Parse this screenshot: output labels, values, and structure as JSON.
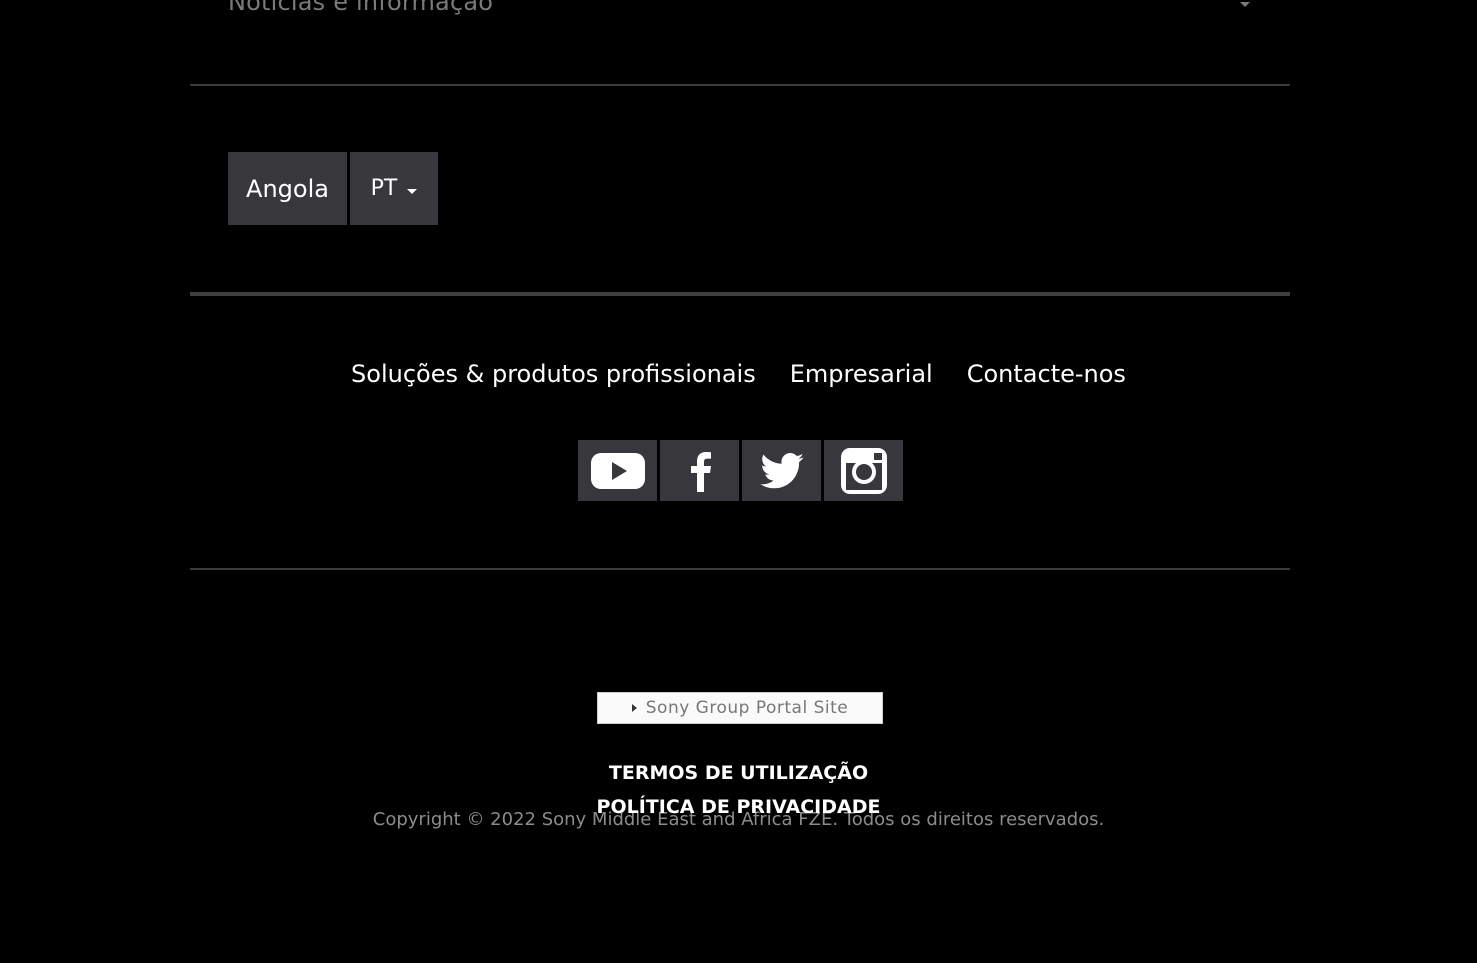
{
  "top_section": {
    "label": "Notícias e informação"
  },
  "locale": {
    "country": "Angola",
    "language": "PT"
  },
  "footer_links": [
    {
      "label": "Soluções & produtos profissionais"
    },
    {
      "label": "Empresarial"
    },
    {
      "label": "Contacte-nos"
    }
  ],
  "social": [
    "youtube-icon",
    "facebook-icon",
    "twitter-icon",
    "instagram-icon"
  ],
  "portal_banner": {
    "label": "Sony Group Portal Site"
  },
  "legal": {
    "terms": "TERMOS DE UTILIZAÇÃO",
    "privacy": "POLÍTICA DE PRIVACIDADE",
    "copyright": "Copyright © 2022 Sony Middle East and Africa FZE. Todos os direitos reservados."
  },
  "colors": {
    "background": "#000000",
    "button": "#38383c",
    "divider": "#3f3f3f"
  }
}
